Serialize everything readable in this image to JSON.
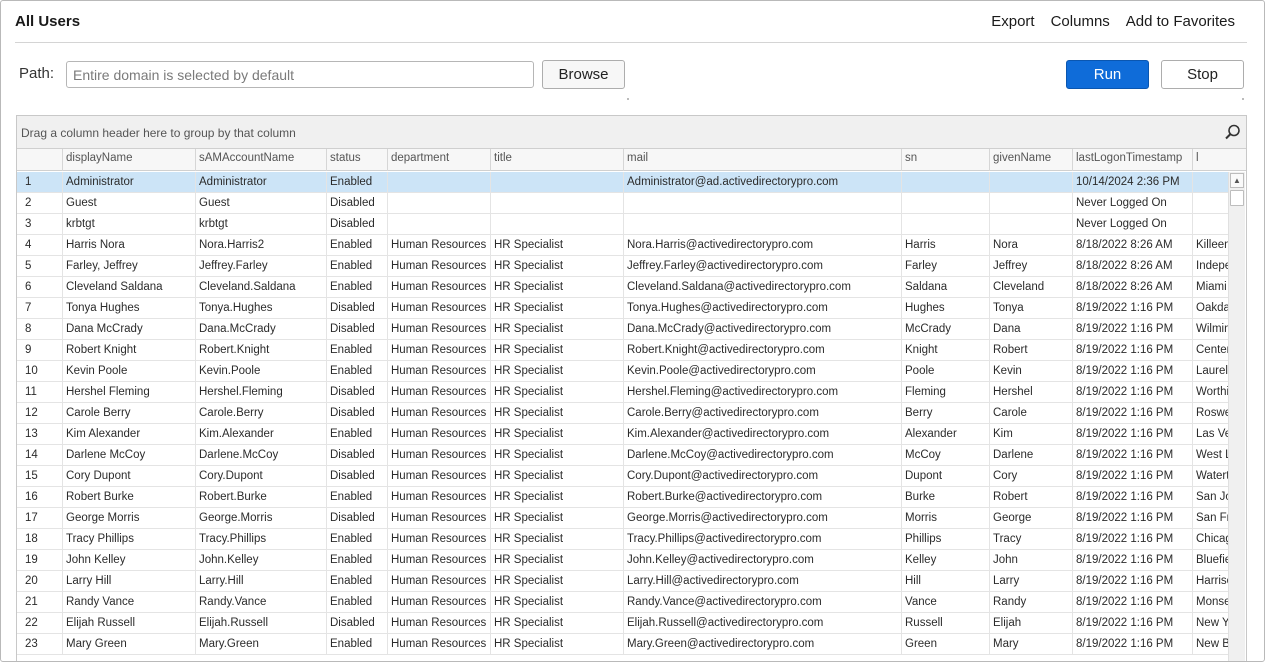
{
  "header": {
    "title": "All Users",
    "export_label": "Export",
    "columns_label": "Columns",
    "favorites_label": "Add to Favorites"
  },
  "path": {
    "label": "Path:",
    "placeholder": "Entire domain is selected by default",
    "value": ""
  },
  "buttons": {
    "browse": "Browse",
    "run": "Run",
    "stop": "Stop"
  },
  "colors": {
    "run_bg": "#0f6cd9",
    "selected_row": "#cce4f7"
  },
  "grid": {
    "group_hint": "Drag a column header here to group by that column",
    "search_icon": "search-icon",
    "columns": [
      "displayName",
      "sAMAccountName",
      "status",
      "department",
      "title",
      "mail",
      "sn",
      "givenName",
      "lastLogonTimestamp",
      "l"
    ],
    "selected_row": 1,
    "rows": [
      [
        "1",
        "Administrator",
        "Administrator",
        "Enabled",
        "",
        "",
        "Administrator@ad.activedirectorypro.com",
        "",
        "",
        "10/14/2024 2:36 PM",
        ""
      ],
      [
        "2",
        "Guest",
        "Guest",
        "Disabled",
        "",
        "",
        "",
        "",
        "",
        "Never Logged On",
        ""
      ],
      [
        "3",
        "krbtgt",
        "krbtgt",
        "Disabled",
        "",
        "",
        "",
        "",
        "",
        "Never Logged On",
        ""
      ],
      [
        "4",
        "Harris Nora",
        "Nora.Harris2",
        "Enabled",
        "Human Resources",
        "HR Specialist",
        "Nora.Harris@activedirectorypro.com",
        "Harris",
        "Nora",
        "8/18/2022 8:26 AM",
        "Killeen"
      ],
      [
        "5",
        "Farley, Jeffrey",
        "Jeffrey.Farley",
        "Enabled",
        "Human Resources",
        "HR Specialist",
        "Jeffrey.Farley@activedirectorypro.com",
        "Farley",
        "Jeffrey",
        "8/18/2022 8:26 AM",
        "Indepe"
      ],
      [
        "6",
        "Cleveland Saldana",
        "Cleveland.Saldana",
        "Enabled",
        "Human Resources",
        "HR Specialist",
        "Cleveland.Saldana@activedirectorypro.com",
        "Saldana",
        "Cleveland",
        "8/18/2022 8:26 AM",
        "Miami S"
      ],
      [
        "7",
        "Tonya Hughes",
        "Tonya.Hughes",
        "Disabled",
        "Human Resources",
        "HR Specialist",
        "Tonya.Hughes@activedirectorypro.com",
        "Hughes",
        "Tonya",
        "8/19/2022 1:16 PM",
        "Oakdal"
      ],
      [
        "8",
        "Dana McCrady",
        "Dana.McCrady",
        "Disabled",
        "Human Resources",
        "HR Specialist",
        "Dana.McCrady@activedirectorypro.com",
        "McCrady",
        "Dana",
        "8/19/2022 1:16 PM",
        "Wilming"
      ],
      [
        "9",
        "Robert Knight",
        "Robert.Knight",
        "Enabled",
        "Human Resources",
        "HR Specialist",
        "Robert.Knight@activedirectorypro.com",
        "Knight",
        "Robert",
        "8/19/2022 1:16 PM",
        "Center"
      ],
      [
        "10",
        "Kevin Poole",
        "Kevin.Poole",
        "Enabled",
        "Human Resources",
        "HR Specialist",
        "Kevin.Poole@activedirectorypro.com",
        "Poole",
        "Kevin",
        "8/19/2022 1:16 PM",
        "Laurel S"
      ],
      [
        "11",
        "Hershel Fleming",
        "Hershel.Fleming",
        "Disabled",
        "Human Resources",
        "HR Specialist",
        "Hershel.Fleming@activedirectorypro.com",
        "Fleming",
        "Hershel",
        "8/19/2022 1:16 PM",
        "Worthi"
      ],
      [
        "12",
        "Carole Berry",
        "Carole.Berry",
        "Disabled",
        "Human Resources",
        "HR Specialist",
        "Carole.Berry@activedirectorypro.com",
        "Berry",
        "Carole",
        "8/19/2022 1:16 PM",
        "Roswel"
      ],
      [
        "13",
        "Kim Alexander",
        "Kim.Alexander",
        "Enabled",
        "Human Resources",
        "HR Specialist",
        "Kim.Alexander@activedirectorypro.com",
        "Alexander",
        "Kim",
        "8/19/2022 1:16 PM",
        "Las Ve"
      ],
      [
        "14",
        "Darlene McCoy",
        "Darlene.McCoy",
        "Disabled",
        "Human Resources",
        "HR Specialist",
        "Darlene.McCoy@activedirectorypro.com",
        "McCoy",
        "Darlene",
        "8/19/2022 1:16 PM",
        "West L"
      ],
      [
        "15",
        "Cory Dupont",
        "Cory.Dupont",
        "Disabled",
        "Human Resources",
        "HR Specialist",
        "Cory.Dupont@activedirectorypro.com",
        "Dupont",
        "Cory",
        "8/19/2022 1:16 PM",
        "Watert"
      ],
      [
        "16",
        "Robert Burke",
        "Robert.Burke",
        "Enabled",
        "Human Resources",
        "HR Specialist",
        "Robert.Burke@activedirectorypro.com",
        "Burke",
        "Robert",
        "8/19/2022 1:16 PM",
        "San Jo"
      ],
      [
        "17",
        "George Morris",
        "George.Morris",
        "Disabled",
        "Human Resources",
        "HR Specialist",
        "George.Morris@activedirectorypro.com",
        "Morris",
        "George",
        "8/19/2022 1:16 PM",
        "San Fra"
      ],
      [
        "18",
        "Tracy Phillips",
        "Tracy.Phillips",
        "Enabled",
        "Human Resources",
        "HR Specialist",
        "Tracy.Phillips@activedirectorypro.com",
        "Phillips",
        "Tracy",
        "8/19/2022 1:16 PM",
        "Chicag"
      ],
      [
        "19",
        "John Kelley",
        "John.Kelley",
        "Enabled",
        "Human Resources",
        "HR Specialist",
        "John.Kelley@activedirectorypro.com",
        "Kelley",
        "John",
        "8/19/2022 1:16 PM",
        "Bluefie"
      ],
      [
        "20",
        "Larry Hill",
        "Larry.Hill",
        "Enabled",
        "Human Resources",
        "HR Specialist",
        "Larry.Hill@activedirectorypro.com",
        "Hill",
        "Larry",
        "8/19/2022 1:16 PM",
        "Harriso"
      ],
      [
        "21",
        "Randy Vance",
        "Randy.Vance",
        "Enabled",
        "Human Resources",
        "HR Specialist",
        "Randy.Vance@activedirectorypro.com",
        "Vance",
        "Randy",
        "8/19/2022 1:16 PM",
        "Monse"
      ],
      [
        "22",
        "Elijah Russell",
        "Elijah.Russell",
        "Disabled",
        "Human Resources",
        "HR Specialist",
        "Elijah.Russell@activedirectorypro.com",
        "Russell",
        "Elijah",
        "8/19/2022 1:16 PM",
        "New Yo"
      ],
      [
        "23",
        "Mary Green",
        "Mary.Green",
        "Enabled",
        "Human Resources",
        "HR Specialist",
        "Mary.Green@activedirectorypro.com",
        "Green",
        "Mary",
        "8/19/2022 1:16 PM",
        "New Br"
      ]
    ]
  }
}
